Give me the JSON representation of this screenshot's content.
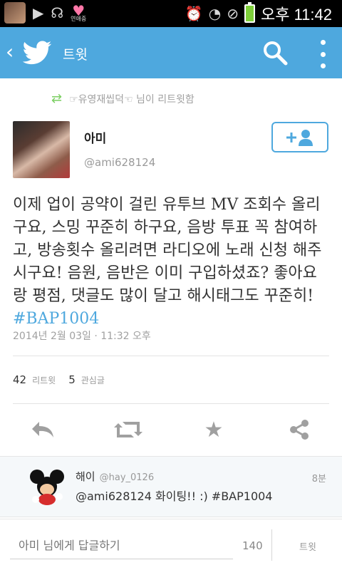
{
  "status_bar": {
    "heart_caption": "연애중",
    "time": "오후 11:42"
  },
  "app_bar": {
    "title": "트윗"
  },
  "retweet_note": "☞유영재씹덕☜ 님이 리트윗함",
  "tweet": {
    "author_name": "아미",
    "author_handle": "@ami628124",
    "text": "이제 업이 공약이 걸린 유투브 MV 조회수 올리구요, 스밍 꾸준히 하구요, 음방 투표 꼭 참여하고, 방송횟수 올리려면 라디오에 노래 신청 해주시구요! 음원, 음반은 이미 구입하셨죠? 좋아요랑 평점, 댓글도 많이 달고 해시태그도 꾸준히! ",
    "hashtag": "#BAP1004",
    "timestamp": "2014년 2월 03일 · 11:32 오후",
    "retweet_count": "42",
    "retweet_label": "리트윗",
    "favorite_count": "5",
    "favorite_label": "관심글"
  },
  "reply": {
    "name": "해이",
    "handle": "@hay_0126",
    "time": "8분",
    "text": "@ami628124 화이팅!! :) #BAP1004"
  },
  "compose": {
    "placeholder": "아미 님에게 답글하기",
    "counter": "140",
    "send_label": "트윗"
  },
  "colors": {
    "accent": "#4ea8de",
    "retweet_green": "#7ccf63"
  }
}
